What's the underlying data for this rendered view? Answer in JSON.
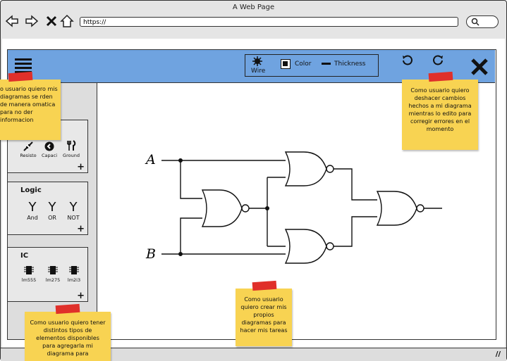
{
  "browser": {
    "title": "A Web Page",
    "url": "https://"
  },
  "toolbar": {
    "wire_label": "Wire",
    "color_label": "Color",
    "thickness_label": "Thickness"
  },
  "sidebar": {
    "components": [
      {
        "label": "Resisto"
      },
      {
        "label": "Capaci"
      },
      {
        "label": "Ground"
      }
    ],
    "logic": {
      "title": "Logic",
      "items": [
        {
          "label": "And"
        },
        {
          "label": "OR"
        },
        {
          "label": "NOT"
        }
      ]
    },
    "ic": {
      "title": "IC",
      "items": [
        {
          "label": "lm555"
        },
        {
          "label": "lm275"
        },
        {
          "label": "lm2i3"
        }
      ]
    },
    "plus": "+"
  },
  "canvas": {
    "input_a": "A",
    "input_b": "B"
  },
  "notes": {
    "top_left": "o usuario quiero mis diagramas se rden de manera omatica para no der informacion",
    "top_right": "Como usuario quiero deshacer cambios hechos a mi diagrama mientras lo edito para corregir errores en el momento",
    "bottom_left": "Como usuario quiero tener distintos tipos de elementos disponibles para agregarla mi diagrama para",
    "bottom_center": "Como usuario quiero crear mis propios diagramas para hacer mis tareas"
  }
}
